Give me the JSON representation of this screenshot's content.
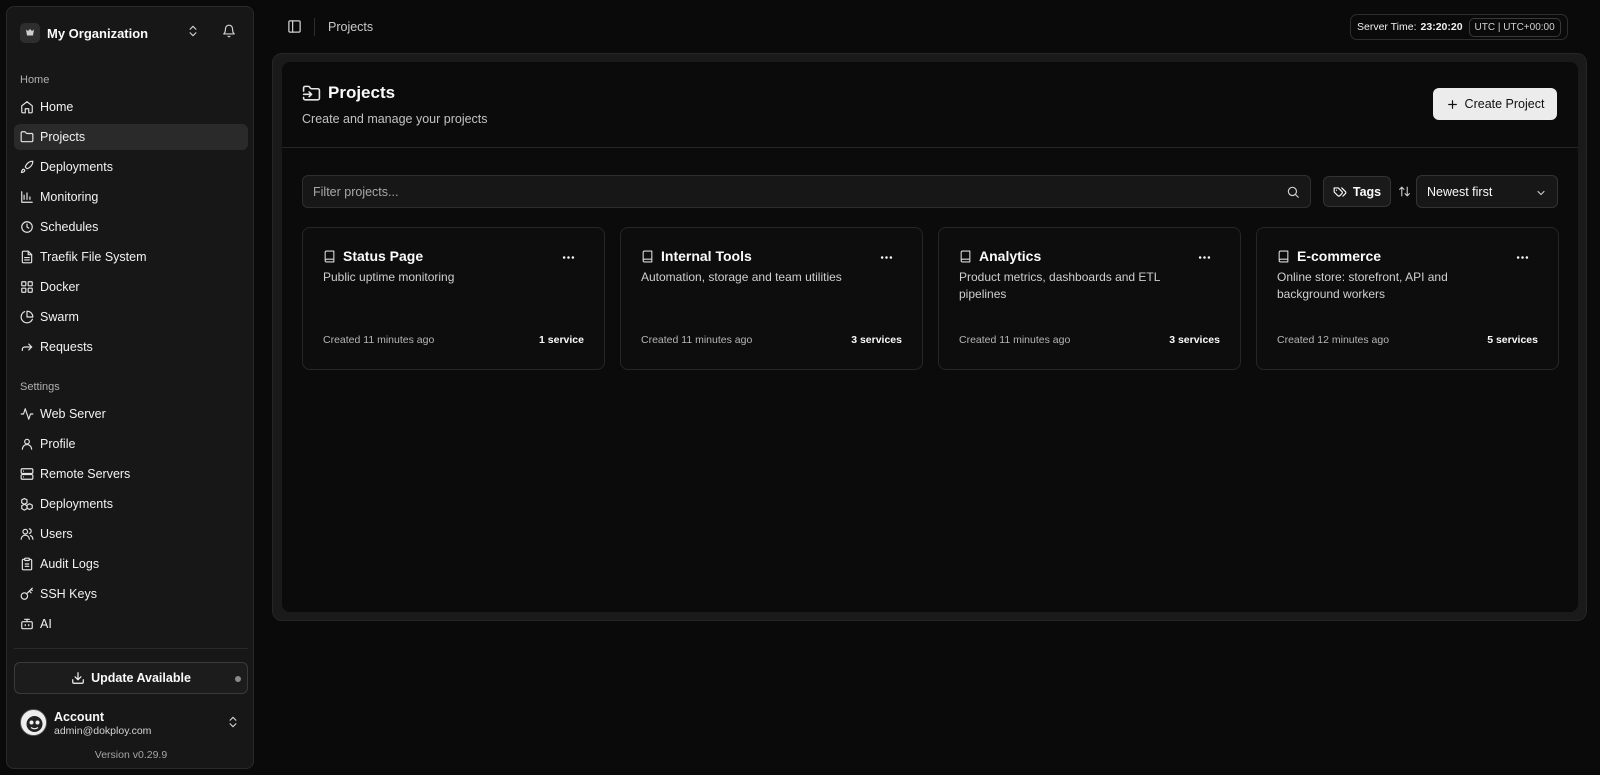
{
  "org": {
    "name": "My Organization"
  },
  "sidebar": {
    "home_label": "Home",
    "home_items": [
      {
        "label": "Home",
        "icon": "home-icon"
      },
      {
        "label": "Projects",
        "icon": "folder-icon",
        "active": true
      },
      {
        "label": "Deployments",
        "icon": "rocket-icon"
      },
      {
        "label": "Monitoring",
        "icon": "chart-icon"
      },
      {
        "label": "Schedules",
        "icon": "clock-icon"
      },
      {
        "label": "Traefik File System",
        "icon": "file-icon"
      },
      {
        "label": "Docker",
        "icon": "blocks-icon"
      },
      {
        "label": "Swarm",
        "icon": "pie-icon"
      },
      {
        "label": "Requests",
        "icon": "forward-icon"
      }
    ],
    "settings_label": "Settings",
    "settings_items": [
      {
        "label": "Web Server",
        "icon": "activity-icon"
      },
      {
        "label": "Profile",
        "icon": "user-icon"
      },
      {
        "label": "Remote Servers",
        "icon": "server-icon"
      },
      {
        "label": "Deployments",
        "icon": "boxes-icon"
      },
      {
        "label": "Users",
        "icon": "users-icon"
      },
      {
        "label": "Audit Logs",
        "icon": "clipboard-icon"
      },
      {
        "label": "SSH Keys",
        "icon": "key-icon"
      },
      {
        "label": "AI",
        "icon": "bot-icon"
      }
    ],
    "update_label": "Update Available",
    "account": {
      "name": "Account",
      "email": "admin@dokploy.com"
    },
    "version": "Version v0.29.9"
  },
  "topbar": {
    "breadcrumb": "Projects",
    "server_time_label": "Server Time:",
    "server_time": "23:20:20",
    "timezone": "UTC | UTC+00:00"
  },
  "page": {
    "title": "Projects",
    "subtitle": "Create and manage your projects",
    "create_label": "Create Project",
    "filter_placeholder": "Filter projects...",
    "tags_label": "Tags",
    "sort_value": "Newest first"
  },
  "projects": [
    {
      "name": "Status Page",
      "description": "Public uptime monitoring",
      "created": "Created 11 minutes ago",
      "services": "1 service"
    },
    {
      "name": "Internal Tools",
      "description": "Automation, storage and team utilities",
      "created": "Created 11 minutes ago",
      "services": "3 services"
    },
    {
      "name": "Analytics",
      "description": "Product metrics, dashboards and ETL pipelines",
      "created": "Created 11 minutes ago",
      "services": "3 services"
    },
    {
      "name": "E-commerce",
      "description": "Online store: storefront, API and background workers",
      "created": "Created 12 minutes ago",
      "services": "5 services"
    }
  ]
}
